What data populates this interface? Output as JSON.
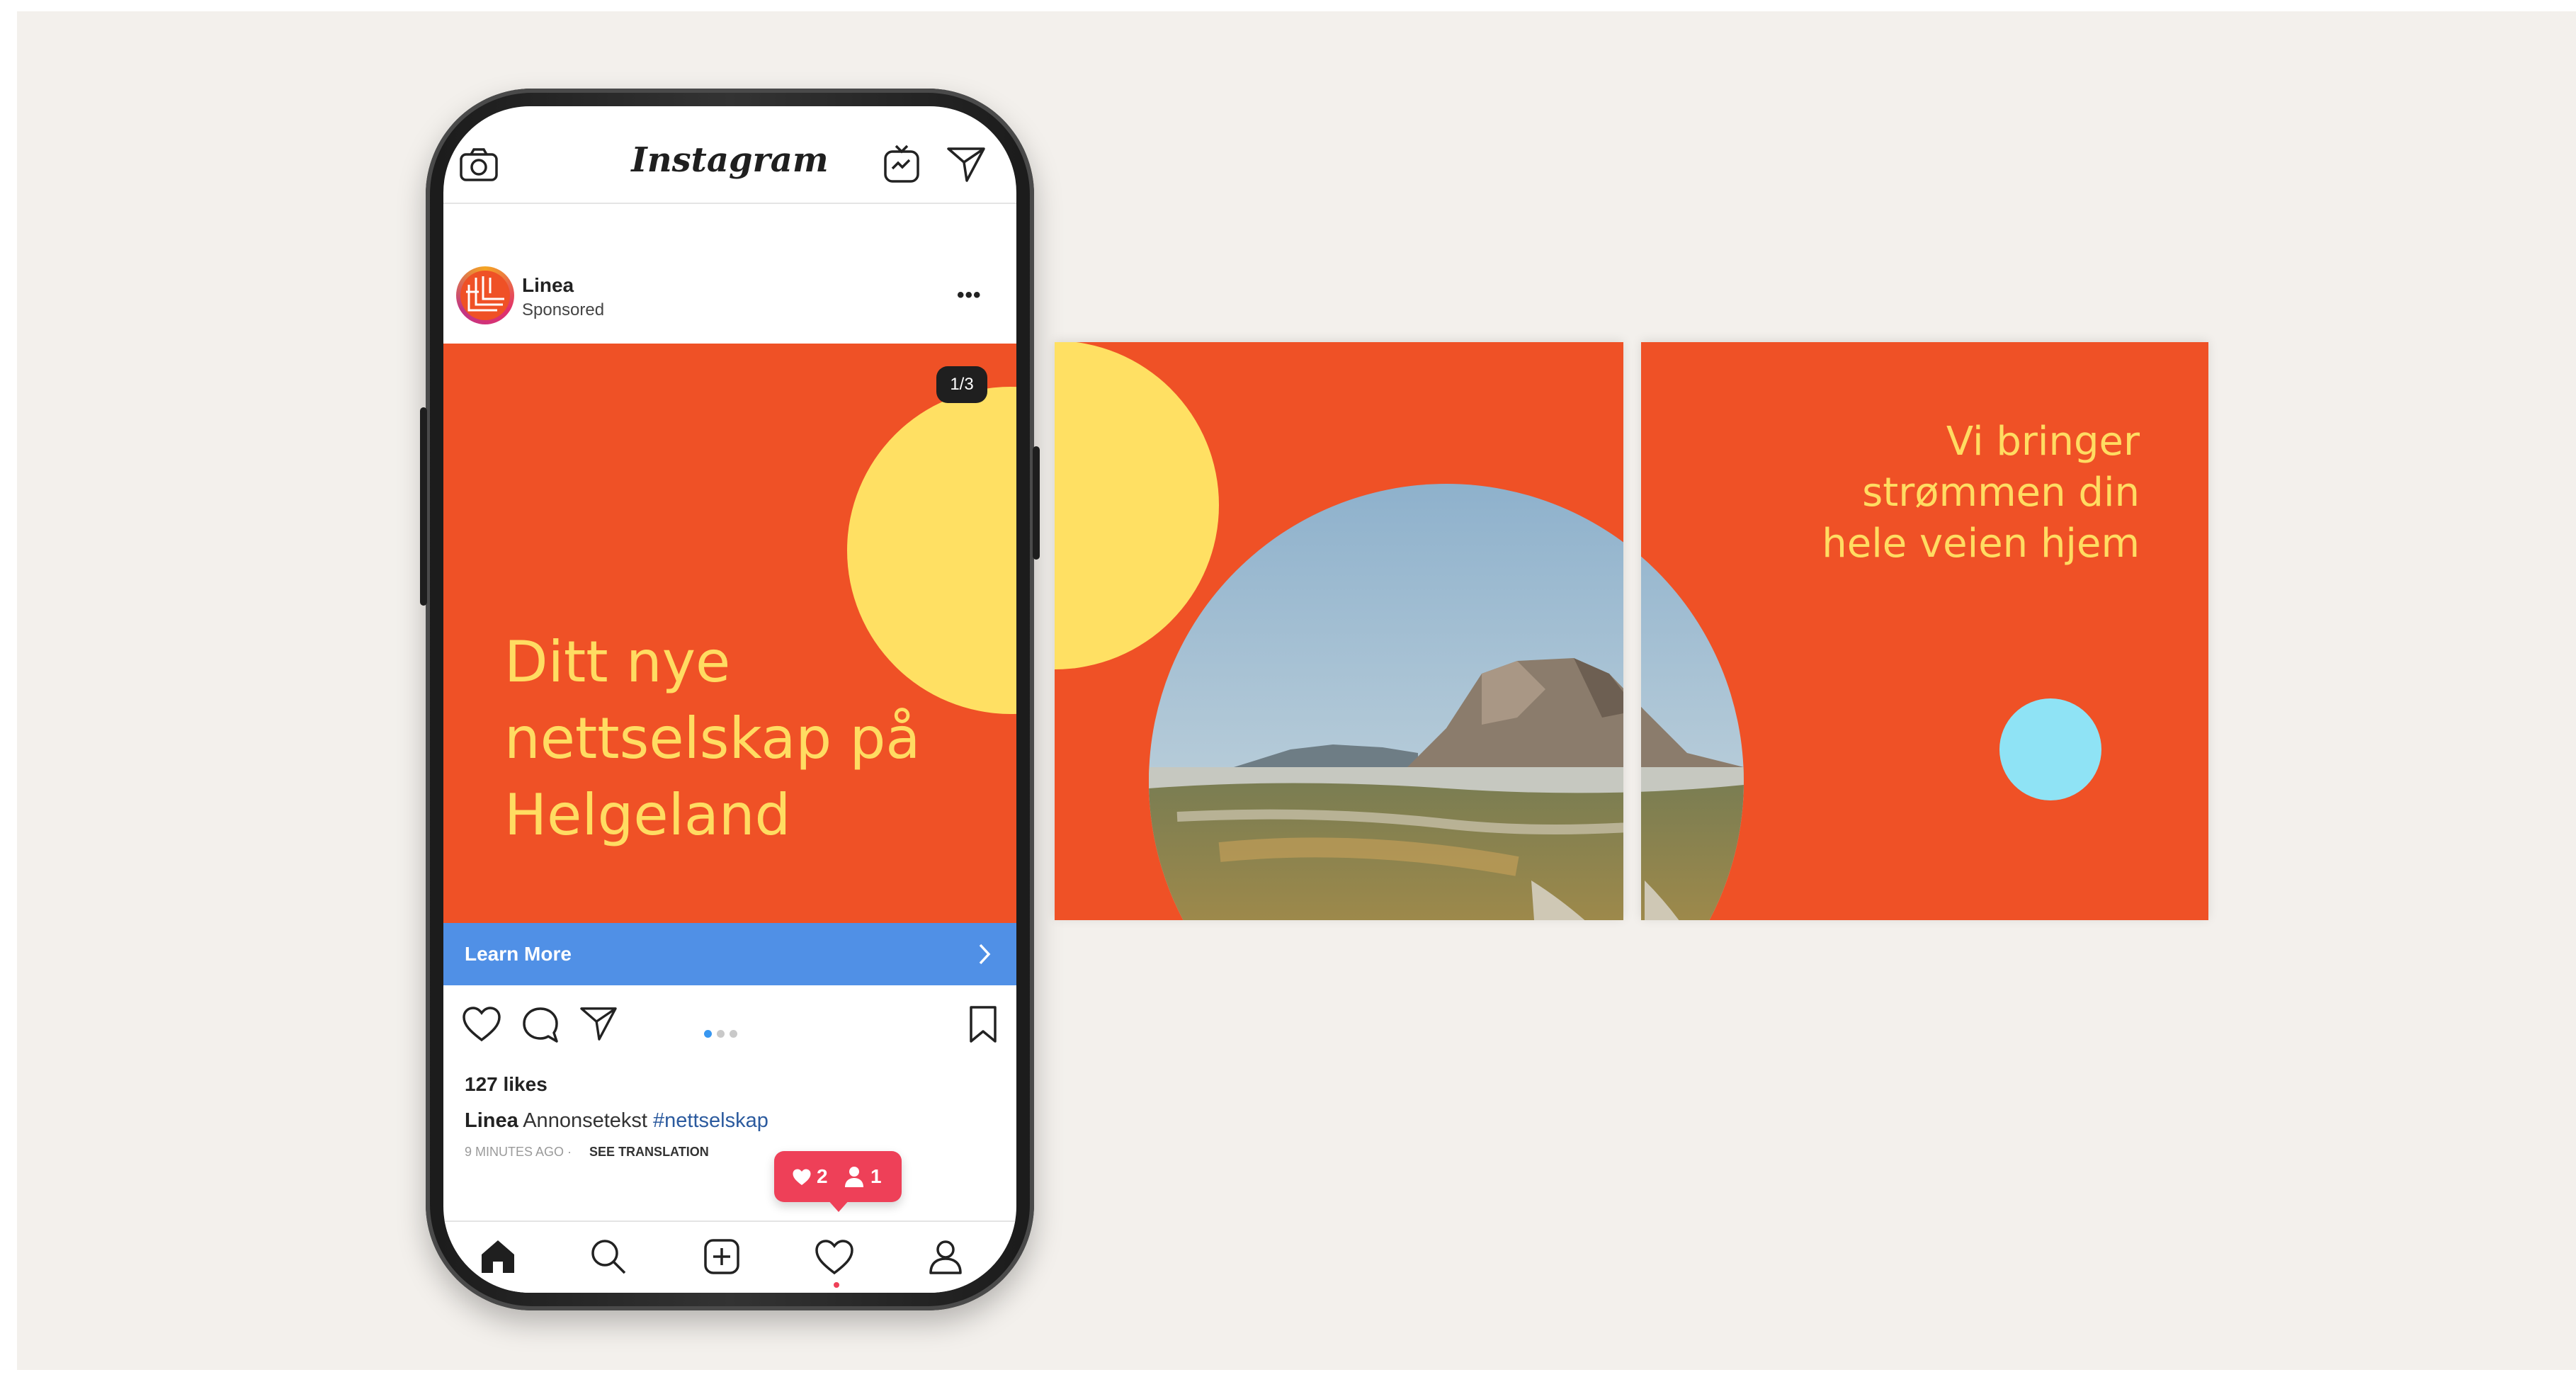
{
  "colors": {
    "background": "#f3f0ec",
    "brand_orange": "#ef5126",
    "brand_yellow": "#ffdc62",
    "cta_blue": "#5090e6",
    "accent_cyan": "#8fe3f5",
    "notification_red": "#ee4058"
  },
  "instagram": {
    "logo_text": "Instagram",
    "top_icons": [
      "camera-icon",
      "igtv-icon",
      "direct-send-icon"
    ],
    "post": {
      "account_name": "Linea",
      "account_sub": "Sponsored",
      "more_label": "•••",
      "slide_counter": "1/3",
      "headline_lines": [
        "Ditt nye",
        "nettselskap på",
        "Helgeland"
      ],
      "cta_label": "Learn More",
      "likes": "127 likes",
      "caption_user": "Linea",
      "caption_text": "Annonsetekst",
      "caption_hashtag": "#nettselskap",
      "time_ago": "9 MINUTES AGO",
      "see_translation": "SEE TRANSLATION"
    },
    "notification": {
      "likes_count": "2",
      "follows_count": "1"
    },
    "bottom_nav": [
      "home-icon",
      "search-icon",
      "new-post-icon",
      "activity-heart-icon",
      "profile-icon"
    ]
  },
  "carousel_panels": {
    "panel_3_lines": [
      "Vi bringer",
      "strømmen din",
      "hele veien hjem"
    ]
  }
}
